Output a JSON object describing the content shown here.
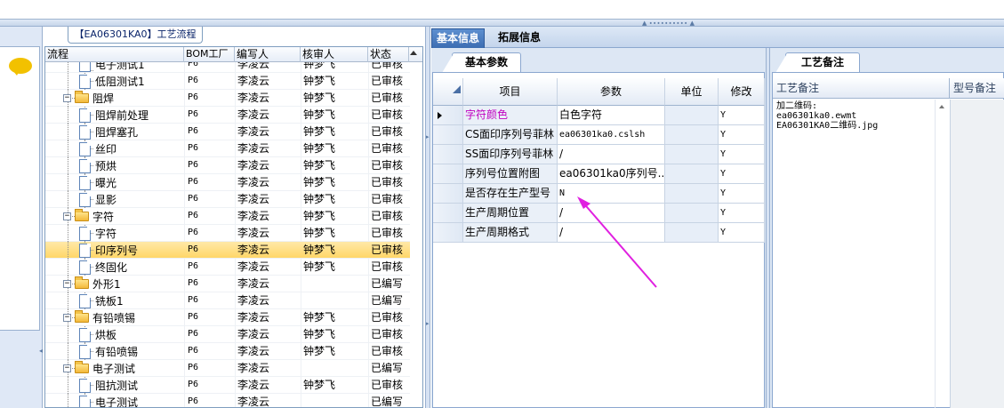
{
  "process_tab": "【EA06301KA0】工艺流程",
  "tree_grid": {
    "headers": [
      "流程",
      "BOM工厂",
      "编写人",
      "核审人",
      "状态"
    ],
    "rows": [
      {
        "level": 2,
        "type": "doc",
        "name": "电子测试1",
        "bom": "P6",
        "writer": "李凌云",
        "reviewer": "钟梦飞",
        "status": "已审核",
        "partial_top": true
      },
      {
        "level": 2,
        "type": "doc",
        "name": "低阻测试1",
        "bom": "P6",
        "writer": "李凌云",
        "reviewer": "钟梦飞",
        "status": "已审核"
      },
      {
        "level": 1,
        "type": "folder",
        "name": "阻焊",
        "bom": "P6",
        "writer": "李凌云",
        "reviewer": "钟梦飞",
        "status": "已审核"
      },
      {
        "level": 2,
        "type": "doc",
        "name": "阻焊前处理",
        "bom": "P6",
        "writer": "李凌云",
        "reviewer": "钟梦飞",
        "status": "已审核"
      },
      {
        "level": 2,
        "type": "doc",
        "name": "阻焊塞孔",
        "bom": "P6",
        "writer": "李凌云",
        "reviewer": "钟梦飞",
        "status": "已审核"
      },
      {
        "level": 2,
        "type": "doc",
        "name": "丝印",
        "bom": "P6",
        "writer": "李凌云",
        "reviewer": "钟梦飞",
        "status": "已审核"
      },
      {
        "level": 2,
        "type": "doc",
        "name": "预烘",
        "bom": "P6",
        "writer": "李凌云",
        "reviewer": "钟梦飞",
        "status": "已审核"
      },
      {
        "level": 2,
        "type": "doc",
        "name": "曝光",
        "bom": "P6",
        "writer": "李凌云",
        "reviewer": "钟梦飞",
        "status": "已审核"
      },
      {
        "level": 2,
        "type": "doc",
        "name": "显影",
        "bom": "P6",
        "writer": "李凌云",
        "reviewer": "钟梦飞",
        "status": "已审核"
      },
      {
        "level": 1,
        "type": "folder",
        "name": "字符",
        "bom": "P6",
        "writer": "李凌云",
        "reviewer": "钟梦飞",
        "status": "已审核"
      },
      {
        "level": 2,
        "type": "doc",
        "name": "字符",
        "bom": "P6",
        "writer": "李凌云",
        "reviewer": "钟梦飞",
        "status": "已审核"
      },
      {
        "level": 2,
        "type": "doc",
        "name": "印序列号",
        "bom": "P6",
        "writer": "李凌云",
        "reviewer": "钟梦飞",
        "status": "已审核",
        "selected": true
      },
      {
        "level": 2,
        "type": "doc",
        "name": "终固化",
        "bom": "P6",
        "writer": "李凌云",
        "reviewer": "钟梦飞",
        "status": "已审核"
      },
      {
        "level": 1,
        "type": "folder",
        "name": "外形1",
        "bom": "P6",
        "writer": "李凌云",
        "reviewer": "",
        "status": "已编写"
      },
      {
        "level": 2,
        "type": "doc",
        "name": "铣板1",
        "bom": "P6",
        "writer": "李凌云",
        "reviewer": "",
        "status": "已编写"
      },
      {
        "level": 1,
        "type": "folder",
        "name": "有铅喷锡",
        "bom": "P6",
        "writer": "李凌云",
        "reviewer": "钟梦飞",
        "status": "已审核"
      },
      {
        "level": 2,
        "type": "doc",
        "name": "烘板",
        "bom": "P6",
        "writer": "李凌云",
        "reviewer": "钟梦飞",
        "status": "已审核"
      },
      {
        "level": 2,
        "type": "doc",
        "name": "有铅喷锡",
        "bom": "P6",
        "writer": "李凌云",
        "reviewer": "钟梦飞",
        "status": "已审核"
      },
      {
        "level": 1,
        "type": "folder",
        "name": "电子测试",
        "bom": "P6",
        "writer": "李凌云",
        "reviewer": "",
        "status": "已编写"
      },
      {
        "level": 2,
        "type": "doc",
        "name": "阻抗测试",
        "bom": "P6",
        "writer": "李凌云",
        "reviewer": "钟梦飞",
        "status": "已审核"
      },
      {
        "level": 2,
        "type": "doc",
        "name": "电子测试",
        "bom": "P6",
        "writer": "李凌云",
        "reviewer": "",
        "status": "已编写"
      }
    ]
  },
  "right_tabs": [
    "基本信息",
    "拓展信息"
  ],
  "basic_params": {
    "tab_label": "基本参数",
    "headers": [
      "项目",
      "参数",
      "单位",
      "修改"
    ],
    "rows": [
      {
        "item": "字符颜色",
        "value": "白色字符",
        "unit": "",
        "modify": "Y",
        "current": true
      },
      {
        "item": "CS面印序列号菲林",
        "value": "ea06301ka0.cslsh",
        "unit": "",
        "modify": "Y"
      },
      {
        "item": "SS面印序列号菲林",
        "value": "/",
        "unit": "",
        "modify": "Y"
      },
      {
        "item": "序列号位置附图",
        "value": "ea06301ka0序列号...",
        "unit": "",
        "modify": "Y"
      },
      {
        "item": "是否存在生产型号",
        "value": "N",
        "unit": "",
        "modify": "Y"
      },
      {
        "item": "生产周期位置",
        "value": "/",
        "unit": "",
        "modify": "Y"
      },
      {
        "item": "生产周期格式",
        "value": "/",
        "unit": "",
        "modify": "Y"
      }
    ]
  },
  "notes": {
    "tab_label": "工艺备注",
    "headers": [
      "工艺备注",
      "型号备注"
    ],
    "text": "加二维码:\nea06301ka0.ewmt\nEA06301KA0二维码.jpg"
  },
  "colors": {
    "accent_tab": "#3c6db2",
    "selection": "#ffd768",
    "highlight_text": "#c000c0",
    "annotation_arrow": "#e020e0"
  }
}
